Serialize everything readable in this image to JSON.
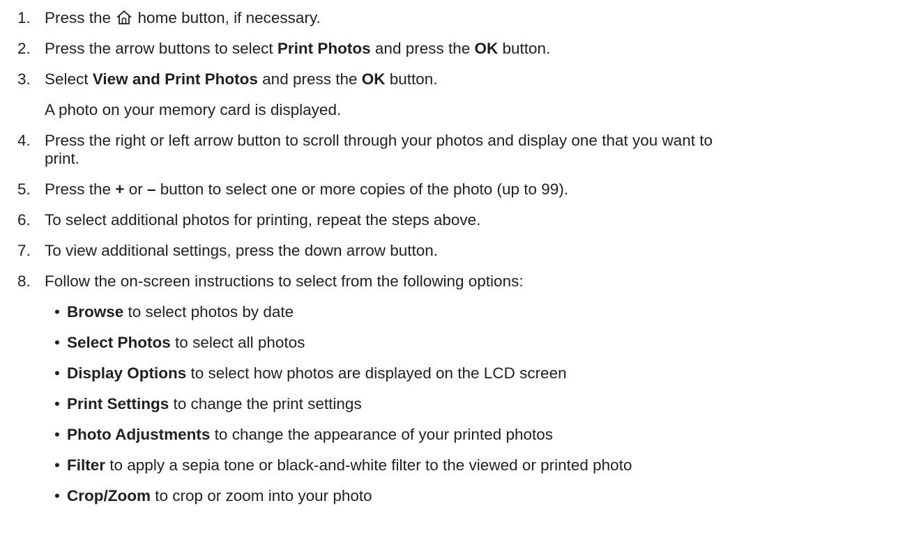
{
  "steps": [
    {
      "num": "1.",
      "pre": "Press the ",
      "icon": "home-icon",
      "post": " home button, if necessary."
    },
    {
      "num": "2.",
      "a": "Press the arrow buttons to select ",
      "b1": "Print Photos",
      "c": " and press the ",
      "b2": "OK",
      "d": " button."
    },
    {
      "num": "3.",
      "a": "Select ",
      "b1": "View and Print Photos",
      "c": " and press the ",
      "b2": "OK",
      "d": " button.",
      "note": "A photo on your memory card is displayed."
    },
    {
      "num": "4.",
      "line1": "Press the right or left arrow button to scroll through your photos and display one that you want to",
      "line2": "print."
    },
    {
      "num": "5.",
      "a": "Press the ",
      "b1": "+",
      "c": " or ",
      "b2": "–",
      "d": " button to select one or more copies of the photo (up to 99)."
    },
    {
      "num": "6.",
      "text": "To select additional photos for printing, repeat the steps above."
    },
    {
      "num": "7.",
      "text": "To view additional settings, press the down arrow button."
    },
    {
      "num": "8.",
      "text": "Follow the on-screen instructions to select from the following options:"
    }
  ],
  "options": [
    {
      "bullet": "•",
      "term": "Browse",
      "desc": " to select photos by date"
    },
    {
      "bullet": "•",
      "term": "Select Photos",
      "desc": " to select all photos"
    },
    {
      "bullet": "•",
      "term": "Display Options",
      "desc": " to select how photos are displayed on the LCD screen"
    },
    {
      "bullet": "•",
      "term": "Print Settings",
      "desc": " to change the print settings"
    },
    {
      "bullet": "•",
      "term": "Photo Adjustments",
      "desc": " to change the appearance of your printed photos"
    },
    {
      "bullet": "•",
      "term": "Filter",
      "desc": " to apply a sepia tone or black-and-white filter to the viewed or printed photo"
    },
    {
      "bullet": "•",
      "term": "Crop/Zoom",
      "desc": " to crop or zoom into your photo"
    }
  ]
}
